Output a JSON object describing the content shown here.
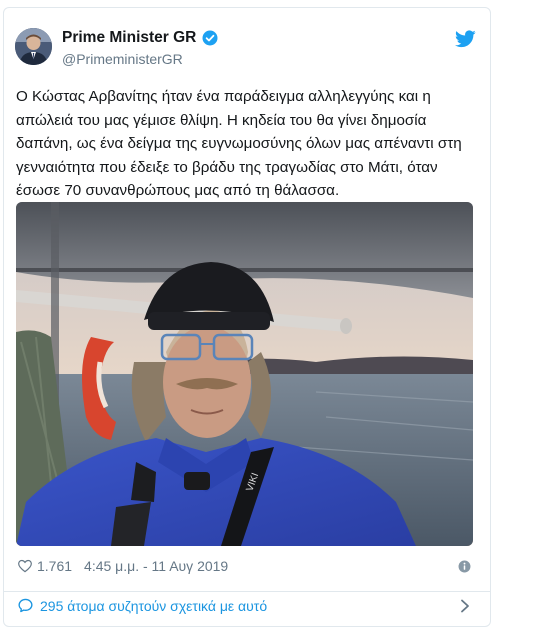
{
  "author": {
    "name": "Prime Minister GR",
    "handle": "@PrimeministerGR",
    "verified": true,
    "avatar_icon": "avatar-photo"
  },
  "tweet": {
    "text": "Ο Κώστας Αρβανίτης ήταν ένα παράδειγμα αλληλεγγύης και η απώλειά του μας γέμισε θλίψη. Η κηδεία του θα γίνει δημοσία δαπάνη, ως ένα δείγμα της ευγνωμοσύνης όλων μας απέναντι στη γενναιότητα που έδειξε το βράδυ της τραγωδίας στο Μάτι, όταν έσωσε 70 συνανθρώπους μας από τη θάλασσα.",
    "image_icon": "tweet-photo"
  },
  "meta": {
    "likes": "1.761",
    "timestamp": "4:45 μ.μ. - 11 Αυγ 2019"
  },
  "conversation": {
    "label": "295 άτομα συζητούν σχετικά με αυτό"
  },
  "icons": {
    "brand": "twitter-bird-icon",
    "verified": "verified-badge-icon",
    "like": "heart-icon",
    "info": "info-icon",
    "conversation": "comment-bubble-icon",
    "chevron": "chevron-right-icon"
  },
  "colors": {
    "brand_blue": "#1da1f2",
    "link_blue": "#1b95e0",
    "text": "#14171a",
    "muted": "#657786",
    "border": "#e1e8ed"
  }
}
